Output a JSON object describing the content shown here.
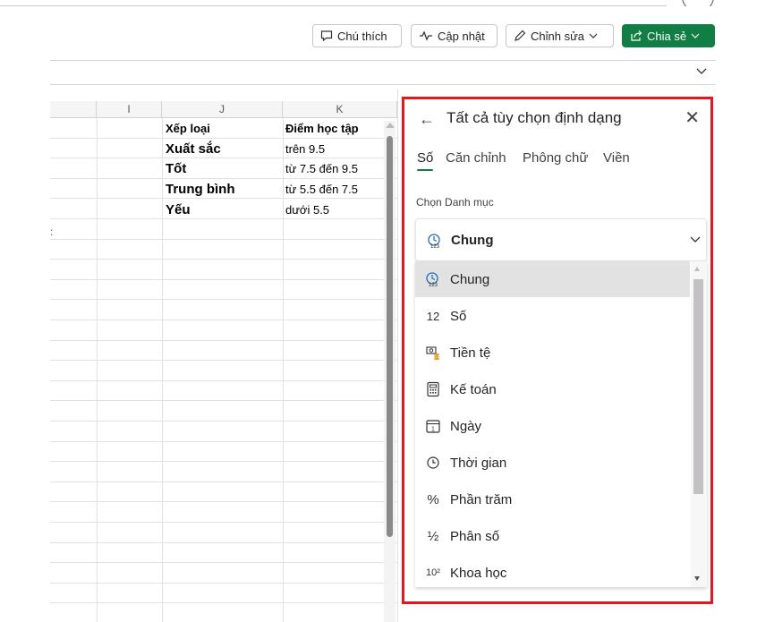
{
  "toolbar": {
    "comment_label": "Chú thích",
    "updates_label": "Cập nhật",
    "editing_label": "Chỉnh sửa",
    "share_label": "Chia sẻ"
  },
  "sheet": {
    "columns": [
      "I",
      "J",
      "K"
    ],
    "table": {
      "header": [
        "Xếp loại",
        "Điểm học tập"
      ],
      "rows": [
        [
          "Xuất sắc",
          "trên 9.5"
        ],
        [
          "Tốt",
          "từ 7.5 đến 9.5"
        ],
        [
          "Trung bình",
          "từ 5.5 đến 7.5"
        ],
        [
          "Yếu",
          "dưới 5.5"
        ]
      ]
    },
    "stray_mark": ":"
  },
  "panel": {
    "title": "Tất cả tùy chọn định dạng",
    "tabs": [
      "Số",
      "Căn chỉnh",
      "Phông chữ",
      "Viền"
    ],
    "active_tab": "Số",
    "category_label": "Chọn Danh mục",
    "selected_category": "Chung",
    "categories": [
      {
        "label": "Chung",
        "icon": "general-format-icon"
      },
      {
        "label": "Số",
        "icon": "number-12-icon",
        "glyph": "12"
      },
      {
        "label": "Tiền tệ",
        "icon": "currency-icon"
      },
      {
        "label": "Kế toán",
        "icon": "calculator-icon"
      },
      {
        "label": "Ngày",
        "icon": "calendar-icon",
        "glyph": "1"
      },
      {
        "label": "Thời gian",
        "icon": "clock-icon"
      },
      {
        "label": "Phần trăm",
        "icon": "percent-icon",
        "glyph": "%"
      },
      {
        "label": "Phân số",
        "icon": "fraction-icon",
        "glyph": "½"
      },
      {
        "label": "Khoa học",
        "icon": "scientific-icon",
        "glyph": "10²"
      }
    ]
  },
  "colors": {
    "accent": "#117e43",
    "panel_border": "#e4161e"
  }
}
